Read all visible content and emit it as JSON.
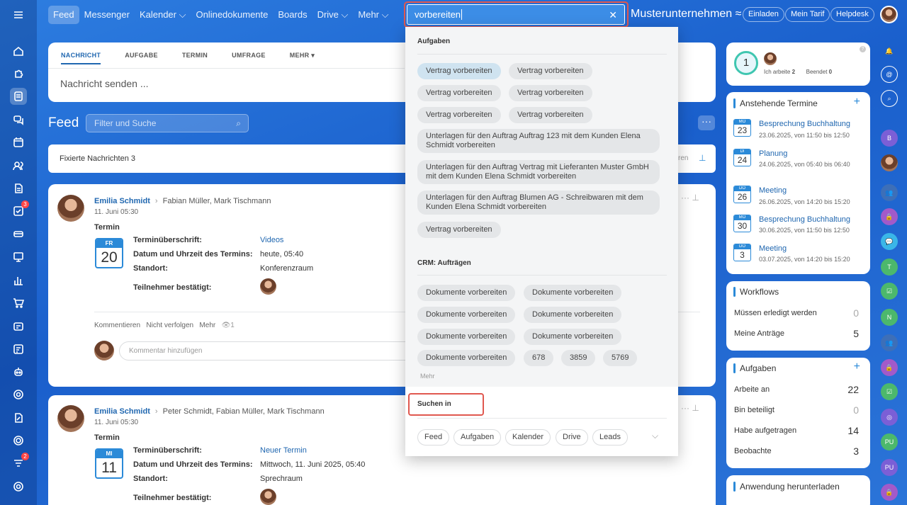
{
  "topnav": {
    "items": [
      "Feed",
      "Messenger",
      "Kalender ⌵",
      "Onlinedokumente",
      "Boards",
      "Drive ⌵",
      "Mehr ⌵"
    ],
    "search_value": "vorbereiten",
    "company": "Musterunternehmen ≈",
    "buttons": [
      "Einladen",
      "Mein Tarif",
      "Helpdesk"
    ]
  },
  "leftrail": {
    "badges": [
      "3",
      "2"
    ]
  },
  "composer": {
    "tabs": [
      "NACHRICHT",
      "AUFGABE",
      "TERMIN",
      "UMFRAGE",
      "MEHR ▾"
    ],
    "placeholder": "Nachricht senden ..."
  },
  "feed": {
    "title": "Feed",
    "filter_placeholder": "Filter und Suche",
    "pinned_label": "Fixierte Nachrichten",
    "pinned_count": "3",
    "pinned_right": "ren"
  },
  "posts": [
    {
      "author": "Emilia Schmidt",
      "recipients": "Fabian Müller, Mark Tischmann",
      "date": "11. Juni 05:30",
      "type": "Termin",
      "cal_day": "FR",
      "cal_num": "20",
      "rows": [
        {
          "label": "Terminüberschrift:",
          "value": "Videos"
        },
        {
          "label": "Datum und Uhrzeit des Termins:",
          "value": "heute, 05:40"
        },
        {
          "label": "Standort:",
          "value": "Konferenzraum"
        },
        {
          "label": "Teilnehmer bestätigt:",
          "value": ""
        }
      ],
      "actions": [
        "Kommentieren",
        "Nicht verfolgen",
        "Mehr",
        "👁1"
      ],
      "comment_placeholder": "Kommentar hinzufügen"
    },
    {
      "author": "Emilia Schmidt",
      "recipients": "Peter Schmidt, Fabian Müller, Mark Tischmann",
      "date": "11. Juni 05:30",
      "type": "Termin",
      "cal_day": "MI",
      "cal_num": "11",
      "rows": [
        {
          "label": "Terminüberschrift:",
          "value": "Neuer Termin"
        },
        {
          "label": "Datum und Uhrzeit des Termins:",
          "value": "Mittwoch, 11. Juni 2025, 05:40"
        },
        {
          "label": "Standort:",
          "value": "Sprechraum"
        },
        {
          "label": "Teilnehmer bestätigt:",
          "value": ""
        }
      ]
    }
  ],
  "dropdown": {
    "section_tasks": "Aufgaben",
    "tasks": [
      "Vertrag vorbereiten",
      "Vertrag vorbereiten",
      "Vertrag vorbereiten",
      "Vertrag vorbereiten",
      "Vertrag vorbereiten",
      "Vertrag vorbereiten",
      "Unterlagen für den Auftrag Auftrag 123 mit dem Kunden Elena Schmidt vorbereiten",
      "Unterlagen für den Auftrag Vertrag mit Lieferanten Muster GmbH mit dem Kunden Elena Schmidt vorbereiten",
      "Unterlagen für den Auftrag Blumen AG - Schreibwaren mit dem Kunden Elena Schmidt vorbereiten",
      "Vertrag vorbereiten"
    ],
    "section_crm": "CRM: Aufträgen",
    "crm": [
      "Dokumente vorbereiten",
      "Dokumente vorbereiten",
      "Dokumente vorbereiten",
      "Dokumente vorbereiten",
      "Dokumente vorbereiten",
      "Dokumente vorbereiten",
      "Dokumente vorbereiten",
      "678",
      "3859",
      "5769"
    ],
    "more": "Mehr",
    "section_search_in": "Suchen in",
    "search_in": [
      "Feed",
      "Aufgaben",
      "Kalender",
      "Drive",
      "Leads"
    ]
  },
  "right": {
    "status": {
      "number": "1",
      "working_label": "Ich arbeite",
      "working": "2",
      "done_label": "Beendet",
      "done": "0"
    },
    "events_title": "Anstehende Termine",
    "events": [
      {
        "day": "MO",
        "num": "23",
        "title": "Besprechung Buchhaltung",
        "date": "23.06.2025, von 11:50 bis 12:50"
      },
      {
        "day": "DI",
        "num": "24",
        "title": "Planung",
        "date": "24.06.2025, von 05:40 bis 06:40"
      },
      {
        "day": "DO",
        "num": "26",
        "title": "Meeting",
        "date": "26.06.2025, von 14:20 bis 15:20"
      },
      {
        "day": "MO",
        "num": "30",
        "title": "Besprechung Buchhaltung",
        "date": "30.06.2025, von 11:50 bis 12:50"
      },
      {
        "day": "DO",
        "num": "3",
        "title": "Meeting",
        "date": "03.07.2025, von 14:20 bis 15:20"
      }
    ],
    "workflows_title": "Workflows",
    "workflows": [
      {
        "label": "Müssen erledigt werden",
        "value": "0"
      },
      {
        "label": "Meine Anträge",
        "value": "5"
      }
    ],
    "tasks_title": "Aufgaben",
    "tasks": [
      {
        "label": "Arbeite an",
        "value": "22"
      },
      {
        "label": "Bin beteiligt",
        "value": "0"
      },
      {
        "label": "Habe aufgetragen",
        "value": "14"
      },
      {
        "label": "Beobachte",
        "value": "3"
      }
    ],
    "download_title": "Anwendung herunterladen",
    "rail_letters": [
      "T",
      "N",
      "PU",
      "PU"
    ]
  },
  "colors": {
    "accent": "#2067b0",
    "highlight": "#e0584f",
    "header": "#1f6fd6"
  }
}
